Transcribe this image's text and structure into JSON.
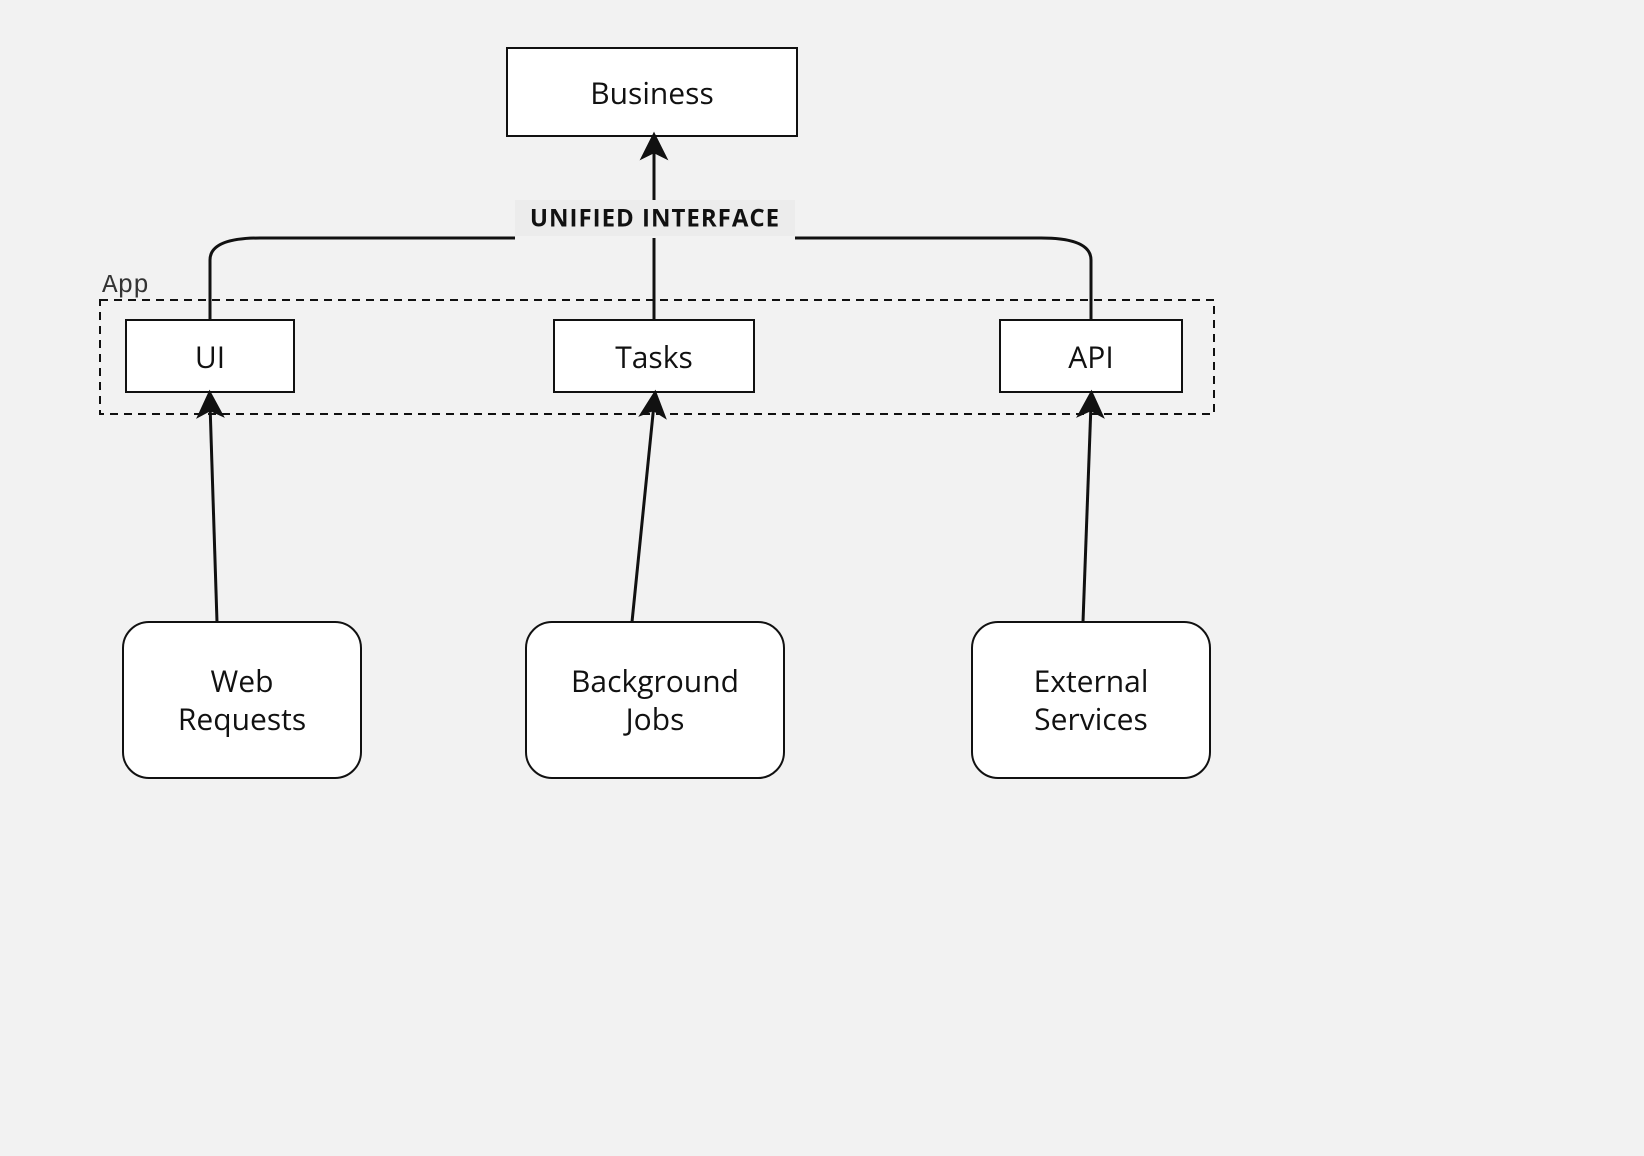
{
  "top_box": {
    "label": "Business"
  },
  "unified_label": "UNIFIED INTERFACE",
  "app_container_label": "App",
  "app_boxes": [
    {
      "id": "ui",
      "label": "UI"
    },
    {
      "id": "tasks",
      "label": "Tasks"
    },
    {
      "id": "api",
      "label": "API"
    }
  ],
  "sources": [
    {
      "id": "web",
      "line1": "Web",
      "line2": "Requests"
    },
    {
      "id": "jobs",
      "line1": "Background",
      "line2": "Jobs"
    },
    {
      "id": "ext",
      "line1": "External",
      "line2": "Services"
    }
  ]
}
